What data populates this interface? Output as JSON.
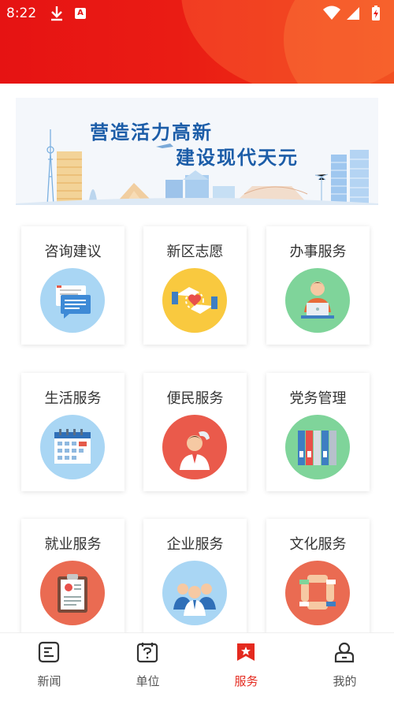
{
  "status_bar": {
    "time": "8:22",
    "letter_icon": "A"
  },
  "banner": {
    "line1": "营造活力高新",
    "line2": "建设现代天元"
  },
  "services": [
    {
      "label": "咨询建议",
      "icon": "chat-bubbles-icon",
      "color": "#a9d6f4"
    },
    {
      "label": "新区志愿",
      "icon": "hands-heart-icon",
      "color": "#f9c93f"
    },
    {
      "label": "办事服务",
      "icon": "person-laptop-icon",
      "color": "#7fd49a"
    },
    {
      "label": "生活服务",
      "icon": "calendar-icon",
      "color": "#a9d6f4"
    },
    {
      "label": "便民服务",
      "icon": "phone-person-icon",
      "color": "#ea5a4b"
    },
    {
      "label": "党务管理",
      "icon": "binders-icon",
      "color": "#7fd49a"
    },
    {
      "label": "就业服务",
      "icon": "clipboard-resume-icon",
      "color": "#ea6b52"
    },
    {
      "label": "企业服务",
      "icon": "team-people-icon",
      "color": "#a9d6f4"
    },
    {
      "label": "文化服务",
      "icon": "joined-hands-icon",
      "color": "#ea6b52"
    }
  ],
  "nav": [
    {
      "label": "新闻",
      "icon": "news-icon"
    },
    {
      "label": "单位",
      "icon": "unit-question-icon"
    },
    {
      "label": "服务",
      "icon": "service-flag-icon",
      "active": true
    },
    {
      "label": "我的",
      "icon": "profile-icon"
    }
  ],
  "colors": {
    "header": "#e61313",
    "active": "#e42a1f",
    "banner_text": "#1c5da8"
  }
}
